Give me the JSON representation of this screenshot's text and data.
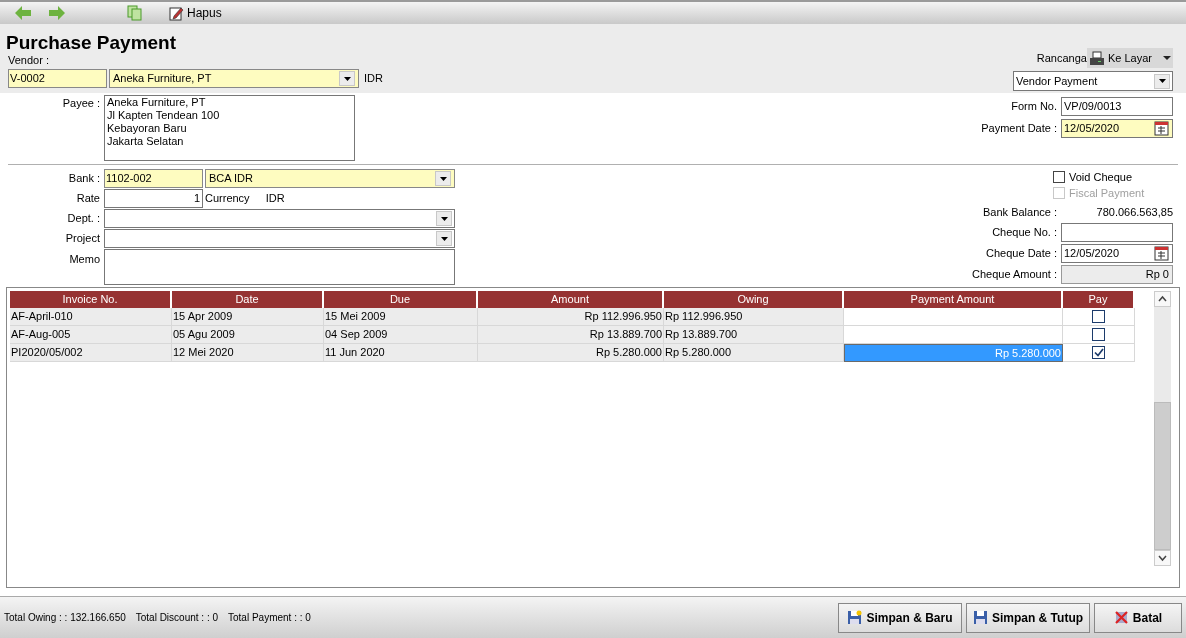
{
  "toolbar": [
    {
      "kind": "back"
    },
    {
      "kind": "forward"
    },
    {
      "kind": "copy"
    },
    {
      "kind": "delete",
      "label": "Hapus"
    }
  ],
  "title": "Purchase Payment",
  "vendor": {
    "label": "Vendor :",
    "code": "V-0002",
    "name": "Aneka Furniture, PT",
    "currency": "IDR"
  },
  "rancangan": {
    "label": "Rancanga",
    "button": "Ke Layar"
  },
  "template": {
    "value": "Vendor Payment"
  },
  "payee": {
    "label": "Payee :",
    "value": "Aneka Furniture, PT\nJl Kapten Tendean 100\nKebayoran Baru\nJakarta Selatan"
  },
  "form_no": {
    "label": "Form No.",
    "value": "VP/09/0013"
  },
  "payment_date": {
    "label": "Payment Date :",
    "value": "12/05/2020"
  },
  "bank": {
    "label": "Bank :",
    "code": "1102-002",
    "name": "BCA IDR"
  },
  "rate": {
    "label": "Rate",
    "value": "1",
    "currency_label": "Currency",
    "currency": "IDR"
  },
  "dept": {
    "label": "Dept. :"
  },
  "project": {
    "label": "Project"
  },
  "memo": {
    "label": "Memo"
  },
  "options": [
    {
      "label": "Void Cheque",
      "checked": false,
      "disabled": false
    },
    {
      "label": "Fiscal Payment",
      "checked": false,
      "disabled": true
    }
  ],
  "bank_balance": {
    "label": "Bank Balance :",
    "value": "780.066.563,85"
  },
  "cheque_no": {
    "label": "Cheque No. :"
  },
  "cheque_date": {
    "label": "Cheque Date :",
    "value": "12/05/2020"
  },
  "cheque_amount": {
    "label": "Cheque Amount :",
    "value": "Rp 0"
  },
  "table": {
    "columns": [
      "Invoice No.",
      "Date",
      "Due",
      "Amount",
      "Owing",
      "Payment Amount",
      "Pay"
    ],
    "rows": [
      {
        "invoice": "AF-April-010",
        "date": "15 Apr 2009",
        "due": "15 Mei 2009",
        "amount": "Rp 112.996.950",
        "owing": "Rp 112.996.950",
        "checked": false,
        "selected": false
      },
      {
        "invoice": "AF-Aug-005",
        "date": "05 Agu 2009",
        "due": "04 Sep 2009",
        "amount": "Rp 13.889.700",
        "owing": "Rp 13.889.700",
        "checked": false,
        "selected": false
      },
      {
        "invoice": "PI2020/05/002",
        "date": "12 Mei 2020",
        "due": "11 Jun 2020",
        "amount": "Rp 5.280.000",
        "owing": "Rp 5.280.000",
        "payment": "Rp 5.280.000",
        "checked": true,
        "selected": true
      }
    ]
  },
  "status": [
    "Total Owing : : 132.166.650",
    "Total Discount : : 0",
    "Total Payment : : 0"
  ],
  "buttons": [
    {
      "kind": "new",
      "label": "Simpan & Baru"
    },
    {
      "kind": "close",
      "label": "Simpan & Tutup"
    },
    {
      "kind": "cancel",
      "label": "Batal"
    }
  ]
}
